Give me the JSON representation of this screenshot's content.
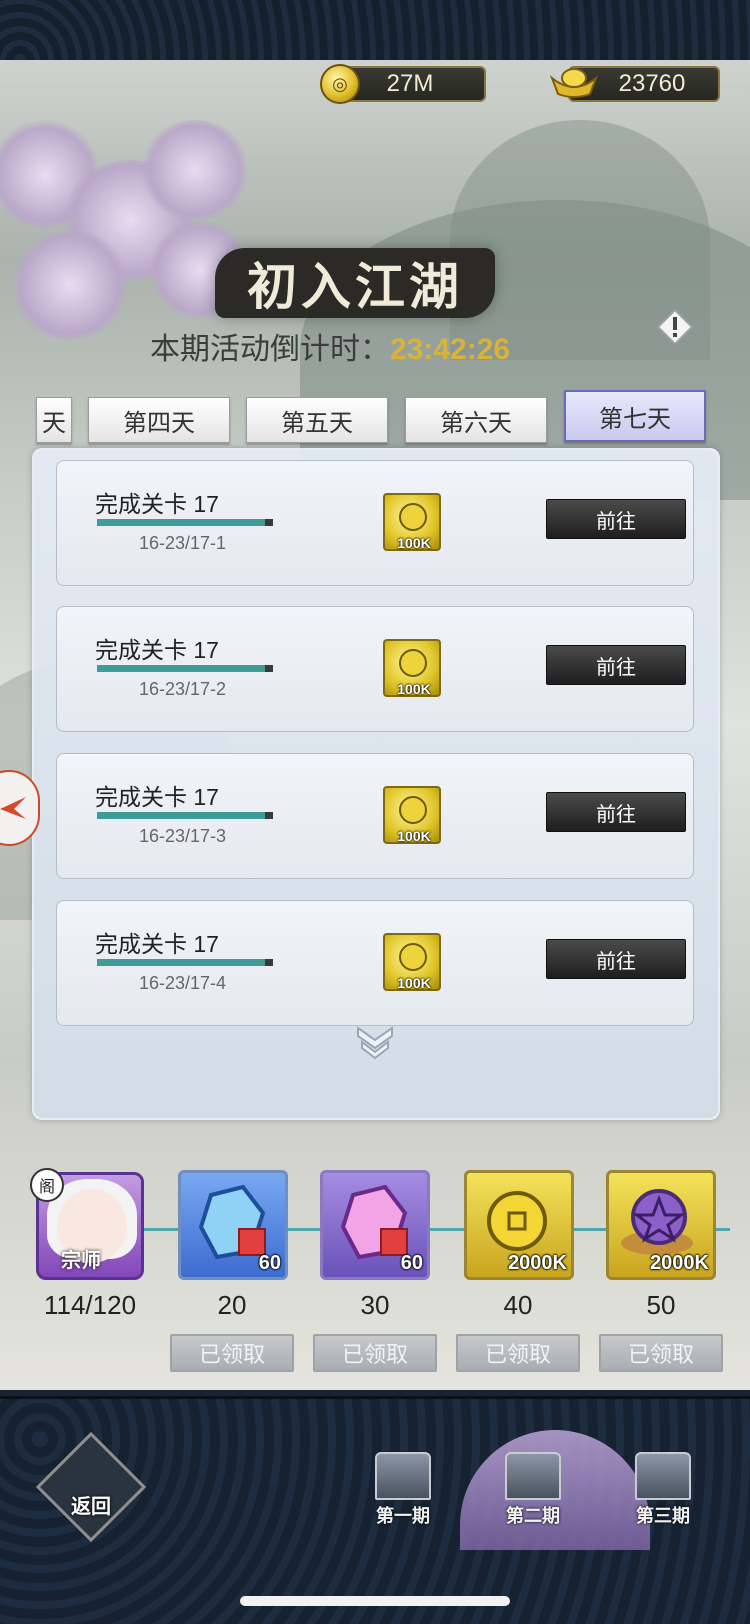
{
  "currency": {
    "coins": "27M",
    "gold_ingots": "23760"
  },
  "event": {
    "title": "初入江湖",
    "countdown_label": "本期活动倒计时：",
    "countdown_time": "23:42:26"
  },
  "day_tabs": [
    {
      "label": "天",
      "active": false
    },
    {
      "label": "第四天",
      "active": false
    },
    {
      "label": "第五天",
      "active": false
    },
    {
      "label": "第六天",
      "active": false
    },
    {
      "label": "第七天",
      "active": true
    }
  ],
  "tasks": [
    {
      "title": "完成关卡 17",
      "subtitle": "16-23/17-1",
      "reward": "100K",
      "button": "前往"
    },
    {
      "title": "完成关卡 17",
      "subtitle": "16-23/17-2",
      "reward": "100K",
      "button": "前往"
    },
    {
      "title": "完成关卡 17",
      "subtitle": "16-23/17-3",
      "reward": "100K",
      "button": "前往"
    },
    {
      "title": "完成关卡 17",
      "subtitle": "16-23/17-4",
      "reward": "100K",
      "button": "前往"
    }
  ],
  "progress": {
    "avatar_tag": "宗师",
    "avatar_badge": "阁",
    "points": "114/120"
  },
  "tiers": [
    {
      "threshold": "20",
      "count": "60",
      "button": "已领取",
      "kind": "blue-gem-shard"
    },
    {
      "threshold": "30",
      "count": "60",
      "button": "已领取",
      "kind": "purple-gem-shard"
    },
    {
      "threshold": "40",
      "count": "2000K",
      "button": "已领取",
      "kind": "gold-coin"
    },
    {
      "threshold": "50",
      "count": "2000K",
      "button": "已领取",
      "kind": "purple-seal"
    }
  ],
  "nav": {
    "back": "返回",
    "phases": [
      "第一期",
      "第二期",
      "第三期"
    ],
    "active_phase": "第二期"
  }
}
